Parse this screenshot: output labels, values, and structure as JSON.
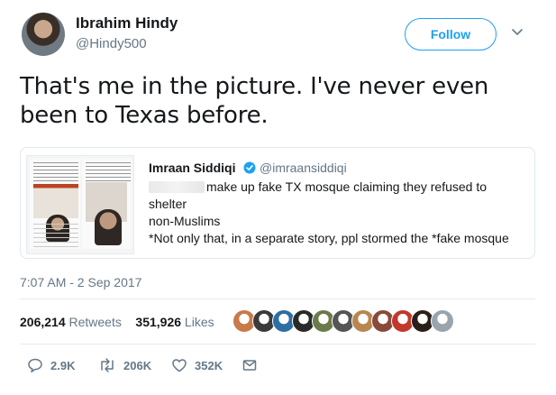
{
  "author": {
    "name": "Ibrahim Hindy",
    "handle": "@Hindy500",
    "follow_label": "Follow"
  },
  "tweet": {
    "text": "That's me in the picture. I've never even been to Texas before."
  },
  "quote": {
    "name": "Imraan Siddiqi",
    "handle": "@imraansiddiqi",
    "line1": "make up fake TX mosque claiming they refused to shelter",
    "line2": "non-Muslims",
    "line3": "*Not only that, in a separate story, ppl stormed the *fake mosque"
  },
  "timestamp": "7:07 AM - 2 Sep 2017",
  "stats": {
    "retweets_count": "206,214",
    "retweets_label": "Retweets",
    "likes_count": "351,926",
    "likes_label": "Likes"
  },
  "liker_faces": [
    "#c9794a",
    "#3b3b3b",
    "#2d6ea3",
    "#2a2a2a",
    "#6b7a4a",
    "#555555",
    "#b8864e",
    "#8a4a3a",
    "#c0392b",
    "#2b1f1a",
    "#9aa4ad"
  ],
  "actions": {
    "reply_count": "2.9K",
    "retweet_count": "206K",
    "like_count": "352K"
  },
  "colors": {
    "accent": "#1da1f2",
    "muted": "#657786",
    "text": "#14171a",
    "border": "#e1e8ed"
  }
}
